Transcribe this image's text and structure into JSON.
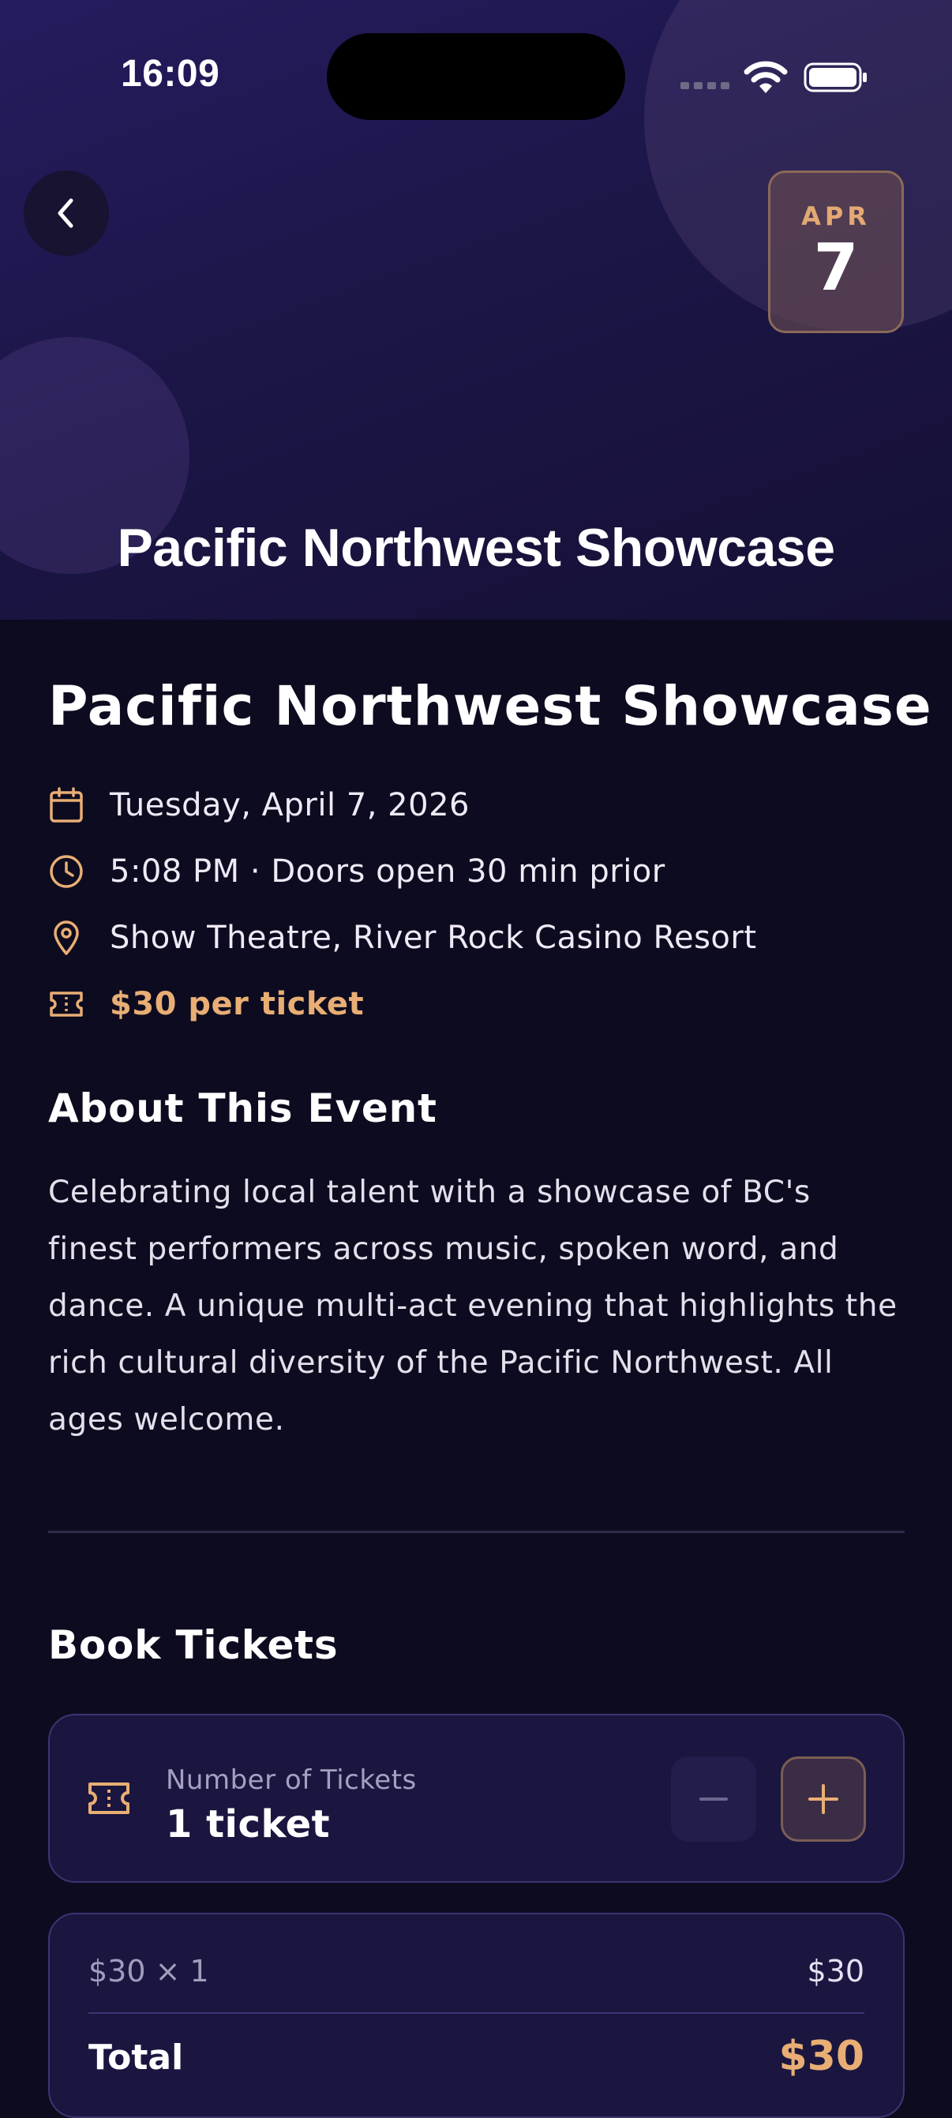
{
  "status_bar": {
    "time": "16:09",
    "icons": [
      "cellular-signal-icon",
      "wifi-icon",
      "battery-icon"
    ]
  },
  "hero": {
    "back_icon": "chevron-left-icon",
    "date_badge": {
      "month": "APR",
      "day": "7"
    },
    "title": "Pacific Northwest Showcase"
  },
  "event": {
    "title": "Pacific Northwest Showcase",
    "details": [
      {
        "icon": "calendar-icon",
        "text": "Tuesday, April 7, 2026"
      },
      {
        "icon": "clock-icon",
        "text": "5:08 PM · Doors open 30 min prior"
      },
      {
        "icon": "location-pin-icon",
        "text": "Show Theatre, River Rock Casino Resort"
      },
      {
        "icon": "ticket-icon",
        "text": "$30 per ticket"
      }
    ]
  },
  "about": {
    "heading": "About This Event",
    "body": "Celebrating local talent with a showcase of BC's finest performers across music, spoken word, and dance. A unique multi-act evening that highlights the rich cultural diversity of the Pacific Northwest. All ages welcome."
  },
  "booking": {
    "heading": "Book Tickets",
    "quantity_label": "Number of Tickets",
    "quantity_value": "1 ticket",
    "line_item_label": "$30 × 1",
    "line_item_value": "$30",
    "total_label": "Total",
    "total_value": "$30"
  },
  "colors": {
    "accent": "#e8ae74",
    "background": "#0d0b1f",
    "hero_gradient_top": "#251c5e",
    "card_background": "#1a1640",
    "card_border": "#3a3573"
  }
}
